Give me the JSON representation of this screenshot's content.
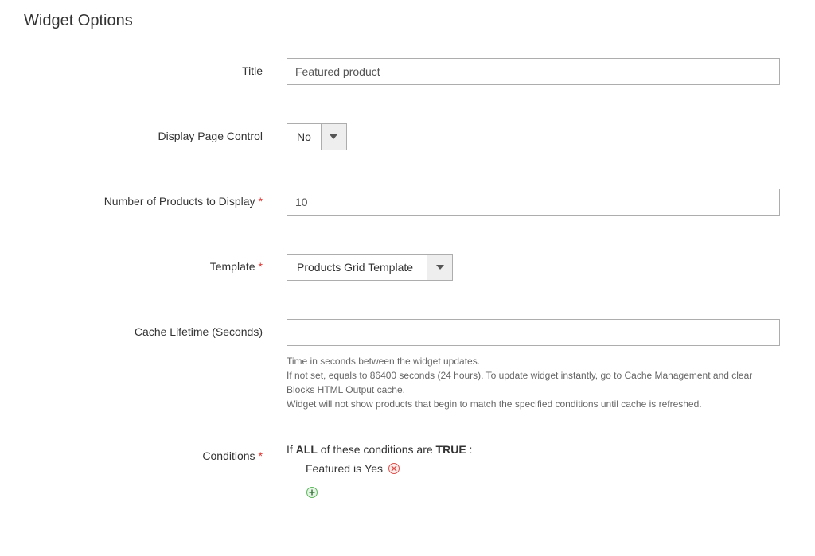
{
  "section": {
    "title": "Widget Options"
  },
  "fields": {
    "title": {
      "label": "Title",
      "value": "Featured product"
    },
    "display_page_control": {
      "label": "Display Page Control",
      "value": "No"
    },
    "num_products": {
      "label": "Number of Products to Display",
      "value": "10"
    },
    "template": {
      "label": "Template",
      "value": "Products Grid Template"
    },
    "cache_lifetime": {
      "label": "Cache Lifetime (Seconds)",
      "value": "",
      "help_line1": "Time in seconds between the widget updates.",
      "help_line2": "If not set, equals to 86400 seconds (24 hours). To update widget instantly, go to Cache Management and clear Blocks HTML Output cache.",
      "help_line3": "Widget will not show products that begin to match the specified conditions until cache is refreshed."
    },
    "conditions": {
      "label": "Conditions",
      "text_if": "If ",
      "text_all": "ALL",
      "text_middle": "  of these conditions are ",
      "text_true": "TRUE",
      "text_colon": " :",
      "rule": {
        "attribute": "Featured",
        "operator": "is",
        "value": "Yes"
      }
    }
  }
}
